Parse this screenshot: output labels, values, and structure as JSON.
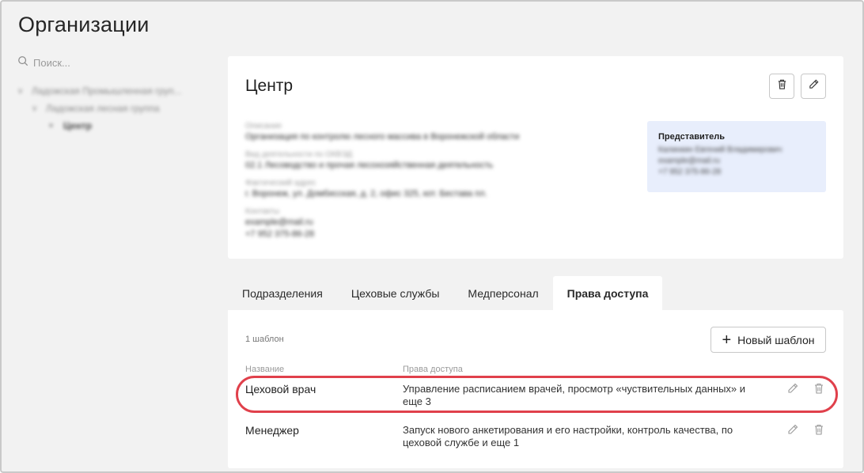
{
  "page": {
    "title": "Организации"
  },
  "sidebar": {
    "search_placeholder": "Поиск...",
    "tree": [
      {
        "label": "Ладожская Промышленная груп...",
        "level": 0
      },
      {
        "label": "Ладожская лесная группа",
        "level": 1
      },
      {
        "label": "Центр",
        "level": 2,
        "selected": true
      }
    ]
  },
  "org": {
    "name": "Центр",
    "fields": [
      {
        "label": "Описание",
        "value": "Организация по контролю лесного массива в Воронежской области"
      },
      {
        "label": "Вид деятельности по ОКВЭД",
        "value": "02.1 Лесоводство и прочая лесохозяйственная деятельность"
      },
      {
        "label": "Фактический адрес",
        "value": "г. Воронеж, ул. Домбисская, д. 2, офис 325, кот. Бестава пл."
      },
      {
        "label": "Контакты",
        "value": "example@mail.ru",
        "value2": "+7 952 375-86-28"
      }
    ],
    "representative": {
      "title": "Представитель",
      "name": "Калинкин Евгений Владимирович",
      "email": "example@mail.ru",
      "phone": "+7 952 375-86-28"
    }
  },
  "tabs": [
    {
      "label": "Подразделения",
      "active": false
    },
    {
      "label": "Цеховые службы",
      "active": false
    },
    {
      "label": "Медперсонал",
      "active": false
    },
    {
      "label": "Права доступа",
      "active": true
    }
  ],
  "templates": {
    "count_text": "1 шаблон",
    "new_button": "Новый шаблон",
    "headers": {
      "name": "Название",
      "rights": "Права доступа"
    },
    "rows": [
      {
        "name": "Цеховой врач",
        "rights": "Управление расписанием врачей, просмотр «чуствительных данных» и еще 3"
      },
      {
        "name": "Менеджер",
        "rights": "Запуск нового анкетирования и его настройки, контроль качества, по цеховой службе и еще 1"
      }
    ]
  },
  "colors": {
    "highlight": "#e0404b",
    "representative_bg": "#e8eefc",
    "background": "#f2f2f2"
  }
}
